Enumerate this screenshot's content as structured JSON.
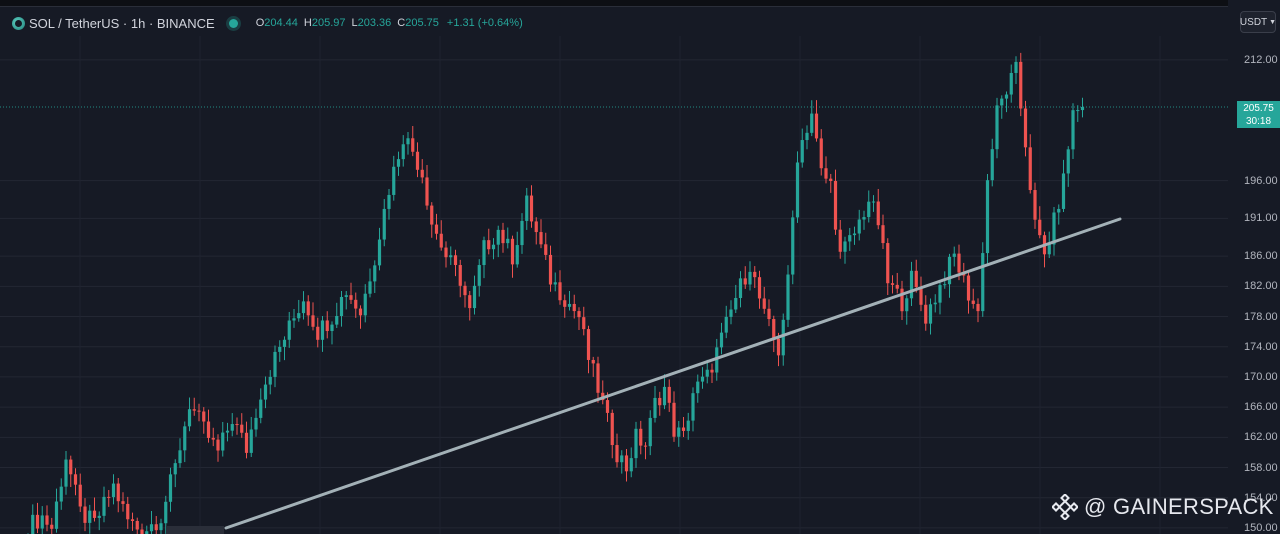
{
  "header": {
    "symbol": "SOL / TetherUS · 1h · BINANCE",
    "open_label": "O",
    "open": "204.44",
    "high_label": "H",
    "high": "205.97",
    "low_label": "L",
    "low": "203.36",
    "close_label": "C",
    "close": "205.75",
    "change": "+1.31 (+0.64%)"
  },
  "currency_button": {
    "label": "USDT"
  },
  "price_tag": {
    "price": "205.75",
    "countdown": "30:18"
  },
  "watermark": {
    "text": "@ GAINERSPACK"
  },
  "colors": {
    "up": "#26a69a",
    "down": "#ef5350",
    "background": "#161a25",
    "trendline": "#a3b1b7"
  },
  "chart_data": {
    "type": "candlestick",
    "symbol": "SOL/USDT",
    "timeframe": "1h",
    "exchange": "BINANCE",
    "yticks": [
      "212.00",
      "196.00",
      "191.00",
      "186.00",
      "182.00",
      "178.00",
      "174.00",
      "170.00",
      "166.00",
      "162.00",
      "158.00",
      "154.00",
      "150.00"
    ],
    "last_price": 205.75,
    "close_path": [
      [
        0,
        150.2
      ],
      [
        3,
        151.5
      ],
      [
        5,
        150.0
      ],
      [
        8,
        159.5
      ],
      [
        11,
        152.0
      ],
      [
        14,
        150.5
      ],
      [
        18,
        155.5
      ],
      [
        21,
        151.0
      ],
      [
        24,
        149.5
      ],
      [
        28,
        151.5
      ],
      [
        31,
        158.0
      ],
      [
        34,
        166.5
      ],
      [
        37,
        163.0
      ],
      [
        40,
        160.0
      ],
      [
        43,
        164.5
      ],
      [
        46,
        160.5
      ],
      [
        49,
        168.0
      ],
      [
        52,
        172.5
      ],
      [
        55,
        176.5
      ],
      [
        58,
        180.5
      ],
      [
        61,
        176.0
      ],
      [
        64,
        178.0
      ],
      [
        67,
        181.5
      ],
      [
        70,
        178.5
      ],
      [
        73,
        186.0
      ],
      [
        76,
        195.0
      ],
      [
        79,
        202.0
      ],
      [
        81,
        200.0
      ],
      [
        83,
        197.0
      ],
      [
        85,
        190.5
      ],
      [
        88,
        186.0
      ],
      [
        91,
        183.0
      ],
      [
        93,
        178.5
      ],
      [
        96,
        187.0
      ],
      [
        99,
        189.5
      ],
      [
        102,
        186.0
      ],
      [
        105,
        193.0
      ],
      [
        107,
        189.0
      ],
      [
        110,
        183.0
      ],
      [
        113,
        180.5
      ],
      [
        116,
        178.0
      ],
      [
        118,
        172.5
      ],
      [
        120,
        168.5
      ],
      [
        122,
        164.0
      ],
      [
        124,
        160.0
      ],
      [
        126,
        158.0
      ],
      [
        128,
        162.0
      ],
      [
        130,
        161.0
      ],
      [
        132,
        166.5
      ],
      [
        134,
        168.5
      ],
      [
        136,
        163.0
      ],
      [
        138,
        162.0
      ],
      [
        140,
        168.0
      ],
      [
        143,
        170.0
      ],
      [
        146,
        175.0
      ],
      [
        149,
        180.5
      ],
      [
        152,
        185.0
      ],
      [
        155,
        178.0
      ],
      [
        158,
        173.5
      ],
      [
        160,
        182.5
      ],
      [
        162,
        199.5
      ],
      [
        165,
        205.0
      ],
      [
        167,
        197.0
      ],
      [
        169,
        195.5
      ],
      [
        171,
        186.0
      ],
      [
        174,
        189.0
      ],
      [
        177,
        193.5
      ],
      [
        179,
        190.5
      ],
      [
        181,
        182.5
      ],
      [
        184,
        180.0
      ],
      [
        186,
        183.0
      ],
      [
        189,
        178.0
      ],
      [
        192,
        182.0
      ],
      [
        195,
        186.0
      ],
      [
        198,
        181.0
      ],
      [
        200,
        178.5
      ],
      [
        202,
        196.0
      ],
      [
        204,
        205.0
      ],
      [
        206,
        208.0
      ],
      [
        208,
        210.5
      ],
      [
        210,
        201.0
      ],
      [
        212,
        190.0
      ],
      [
        214,
        186.0
      ],
      [
        216,
        190.5
      ],
      [
        218,
        196.0
      ],
      [
        220,
        205.0
      ],
      [
        222,
        205.75
      ]
    ],
    "trendline": [
      [
        0,
        150.3
      ],
      [
        238,
        191.2
      ]
    ]
  }
}
